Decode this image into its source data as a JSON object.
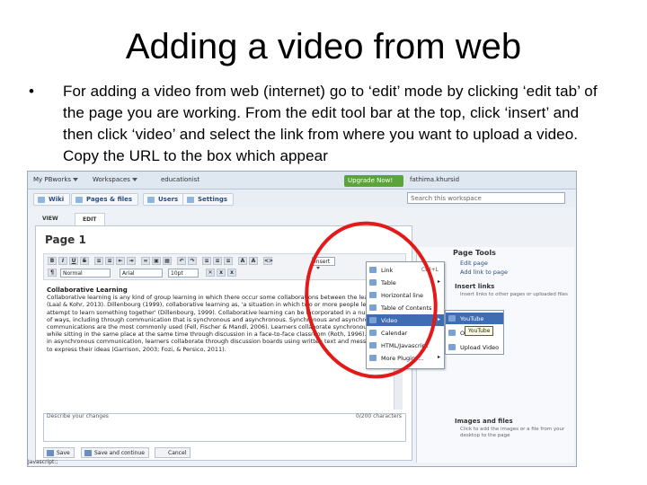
{
  "slide": {
    "title": "Adding a video from web",
    "bullet_marker": "•",
    "bullet_text": "For adding a video from web (internet) go to ‘edit’ mode by clicking ‘edit tab’ of the page you are working. From the edit tool bar at the top, click ‘insert’ and then click ‘video’ and select the link from where you want to upload a video. Copy the URL to the box which appear"
  },
  "screenshot": {
    "topbar": {
      "my_pbworks": "My PBworks",
      "workspaces": "Workspaces",
      "workspace_name": "educationist",
      "upgrade": "Upgrade Now!",
      "account": "fathima.khursid"
    },
    "nav_tabs": [
      "Wiki",
      "Pages & files",
      "Users",
      "Settings"
    ],
    "search_value": "Search this workspace",
    "view_tab": "VIEW",
    "edit_tab": "EDIT",
    "page_title": "Page 1",
    "toolbar": {
      "font_select": "Arial",
      "size_select": "10pt",
      "insert_label": "Insert"
    },
    "content_heading": "Collaborative Learning",
    "content_body": "Collaborative learning is any kind of group learning in which there occur some collaborations between the learners (Laal & Kohr, 2013). Dillenbourg (1999), collaborative learning as, 'a situation in which two or more people learn or attempt to learn something together' (Dillenbourg, 1999). Collaborative learning can be incorporated in a number of ways, including through communication that is synchronous and asynchronous. Synchronous and asynchronous communications are the most commonly used (Fell, Fischer & Mandl, 2006). Learners collaborate synchronously while sitting in the same place at the same time through discussion in a face-to-face classroom (Roth, 1996). While in asynchronous communication, learners collaborate through discussion boards using written text and messages to express their ideas (Garrison, 2003; Fozi, & Persico, 2011).",
    "comment_label": "Describe your changes",
    "comment_count": "0/200 characters",
    "save_buttons": [
      "Save",
      "Save and continue",
      "Cancel"
    ],
    "insert_menu": [
      {
        "label": "Link",
        "shortcut": "Ctrl+L"
      },
      {
        "label": "Table"
      },
      {
        "label": "Horizontal line"
      },
      {
        "label": "Table of Contents"
      },
      {
        "label": "Video"
      },
      {
        "label": "Calendar"
      },
      {
        "label": "HTML/Javascript"
      },
      {
        "label": "More Plugins..."
      }
    ],
    "video_submenu": [
      "YouTube",
      "Other...",
      "Upload Video"
    ],
    "tooltip": "YouTube",
    "page_tools": {
      "heading": "Page Tools",
      "rows": [
        "Edit page",
        "Add link to page"
      ],
      "insert_links_heading": "Insert links",
      "insert_links_note": "Insert links to other pages or uploaded files",
      "images_heading": "Images and files",
      "images_note": "Click to add the images or a file from your desktop to the page"
    },
    "status": "Javascript:;"
  }
}
